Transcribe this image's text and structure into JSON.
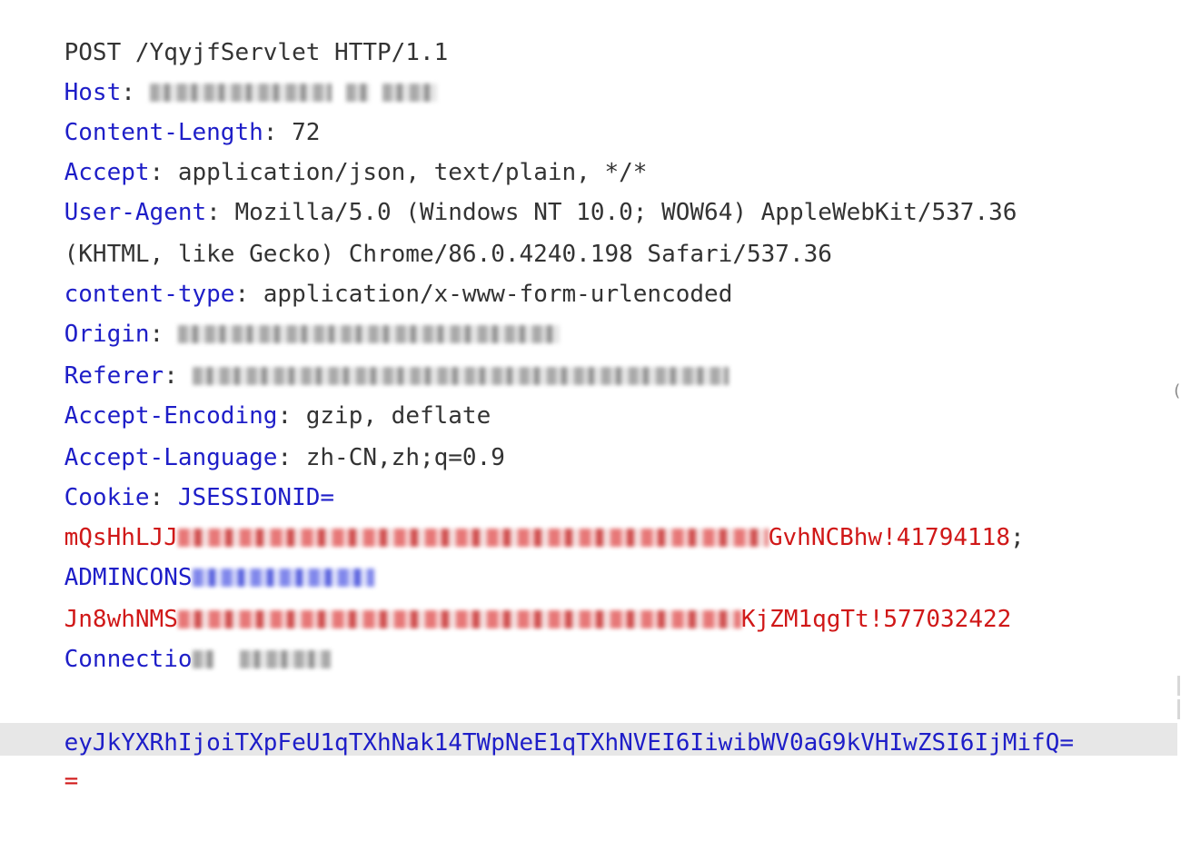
{
  "request_line": "POST /YqyjfServlet HTTP/1.1",
  "headers": {
    "host": {
      "name": "Host",
      "sep": ": "
    },
    "content_length": {
      "name": "Content-Length",
      "sep": ": ",
      "value": "72"
    },
    "accept": {
      "name": "Accept",
      "sep": ": ",
      "value": "application/json, text/plain, */*"
    },
    "user_agent": {
      "name": "User-Agent",
      "sep": ": ",
      "value_line1": "Mozilla/5.0 (Windows NT 10.0; WOW64) AppleWebKit/537.36",
      "value_line2": "(KHTML, like Gecko) Chrome/86.0.4240.198 Safari/537.36"
    },
    "content_type": {
      "name": "content-type",
      "sep": ": ",
      "value": "application/x-www-form-urlencoded"
    },
    "origin": {
      "name": "Origin",
      "sep": ": "
    },
    "referer": {
      "name": "Referer",
      "sep": ": "
    },
    "accept_encoding": {
      "name": "Accept-Encoding",
      "sep": ": ",
      "value": "gzip, deflate"
    },
    "accept_language": {
      "name": "Accept-Language",
      "sep": ": ",
      "value": "zh-CN,zh;q=0.9"
    },
    "cookie": {
      "name": "Cookie",
      "sep": ": ",
      "jsession_key": "JSESSIONID=",
      "jsession_prefix": "mQsHhLJJ",
      "jsession_suffix": "GvhNCBhw!41794118",
      "semicolon": ";",
      "admin_key": "ADMINCONS",
      "admin_prefix": "Jn8whNMS",
      "admin_suffix": "KjZM1qgTt!577032422"
    },
    "connection": {
      "name": "Connectio"
    }
  },
  "body": {
    "line1": "eyJkYXRhIjoiTXpFeU1qTXhNak14TWpNeE1qTXhNVEI6IiwibWV0aG9kVHIwZSI6IjMifQ=",
    "line2": "="
  }
}
